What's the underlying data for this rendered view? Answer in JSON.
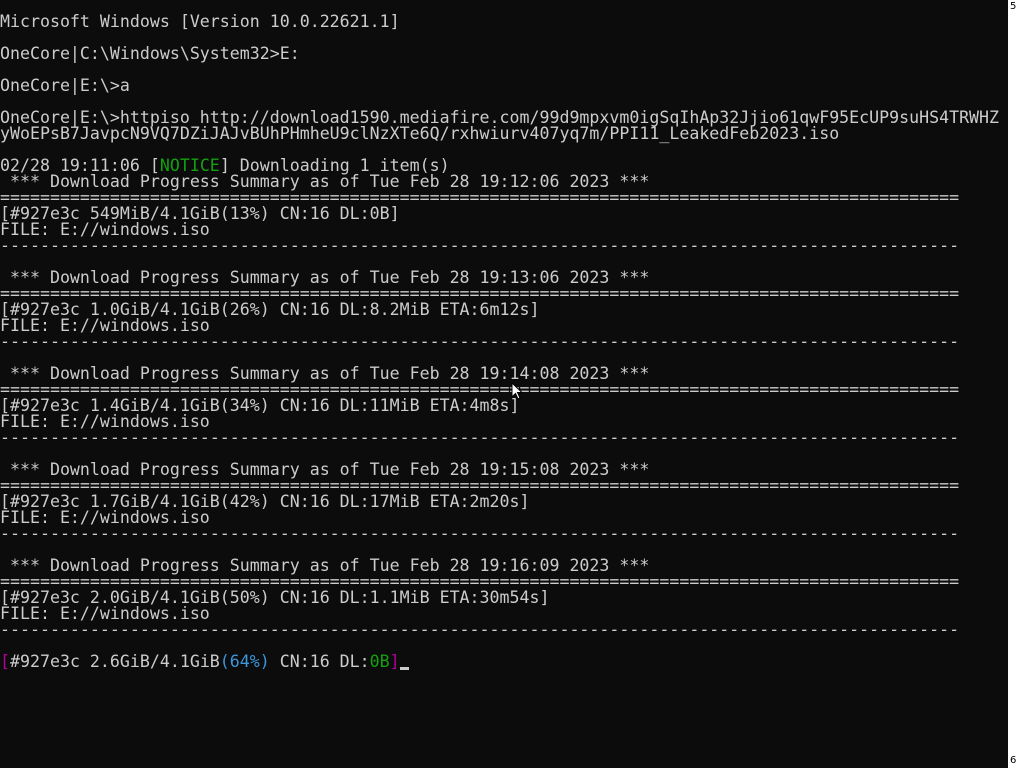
{
  "console": {
    "lines": [
      {
        "t": "Microsoft Windows [Version 10.0.22621.1]"
      },
      {
        "t": ""
      },
      {
        "t": "OneCore|C:\\Windows\\System32>E:"
      },
      {
        "t": ""
      },
      {
        "t": "OneCore|E:\\>a"
      },
      {
        "t": ""
      },
      {
        "t": "OneCore|E:\\>httpiso http://download1590.mediafire.com/99d9mpxvm0igSqIhAp32Jjio61qwF95EcUP9suHS4TRWHZ"
      },
      {
        "t": "yWoEPsB7JavpcN9VQ7DZiJAJvBUhPHmheU9clNzXTe6Q/rxhwiurv407yq7m/PPI11_LeakedFeb2023.iso"
      },
      {
        "t": ""
      },
      {
        "t": "02/28 19:11:06 [",
        "notice": "NOTICE",
        "rest": "] Downloading 1 item(s)"
      },
      {
        "t": " *** Download Progress Summary as of Tue Feb 28 19:12:06 2023 ***"
      },
      {
        "t": "================================================================================================"
      },
      {
        "t": "[#927e3c 549MiB/4.1GiB(13%) CN:16 DL:0B]"
      },
      {
        "t": "FILE: E://windows.iso"
      },
      {
        "t": "------------------------------------------------------------------------------------------------"
      },
      {
        "t": ""
      },
      {
        "t": " *** Download Progress Summary as of Tue Feb 28 19:13:06 2023 ***"
      },
      {
        "t": "================================================================================================"
      },
      {
        "t": "[#927e3c 1.0GiB/4.1GiB(26%) CN:16 DL:8.2MiB ETA:6m12s]"
      },
      {
        "t": "FILE: E://windows.iso"
      },
      {
        "t": "------------------------------------------------------------------------------------------------"
      },
      {
        "t": ""
      },
      {
        "t": " *** Download Progress Summary as of Tue Feb 28 19:14:08 2023 ***"
      },
      {
        "t": "================================================================================================"
      },
      {
        "t": "[#927e3c 1.4GiB/4.1GiB(34%) CN:16 DL:11MiB ETA:4m8s]"
      },
      {
        "t": "FILE: E://windows.iso"
      },
      {
        "t": "------------------------------------------------------------------------------------------------"
      },
      {
        "t": ""
      },
      {
        "t": " *** Download Progress Summary as of Tue Feb 28 19:15:08 2023 ***"
      },
      {
        "t": "================================================================================================"
      },
      {
        "t": "[#927e3c 1.7GiB/4.1GiB(42%) CN:16 DL:17MiB ETA:2m20s]"
      },
      {
        "t": "FILE: E://windows.iso"
      },
      {
        "t": "------------------------------------------------------------------------------------------------"
      },
      {
        "t": ""
      },
      {
        "t": " *** Download Progress Summary as of Tue Feb 28 19:16:09 2023 ***"
      },
      {
        "t": "================================================================================================"
      },
      {
        "t": "[#927e3c 2.0GiB/4.1GiB(50%) CN:16 DL:1.1MiB ETA:30m54s]"
      },
      {
        "t": "FILE: E://windows.iso"
      },
      {
        "t": "------------------------------------------------------------------------------------------------"
      },
      {
        "t": ""
      }
    ],
    "progress": {
      "open_bracket": "[",
      "gid": "#927e3c 2.6GiB/4.1GiB",
      "percent": "(64%)",
      "cn": " CN:16 DL:",
      "dl_value": "0B",
      "close_bracket": "]"
    }
  },
  "scrollbar": {
    "top_label": "5",
    "bottom_label": "6"
  },
  "colors": {
    "background": "#0c0c0c",
    "text": "#cccccc",
    "notice": "#13a10e",
    "bracket": "#b4009e",
    "percent": "#3a96dd",
    "dl_value": "#13a10e"
  }
}
